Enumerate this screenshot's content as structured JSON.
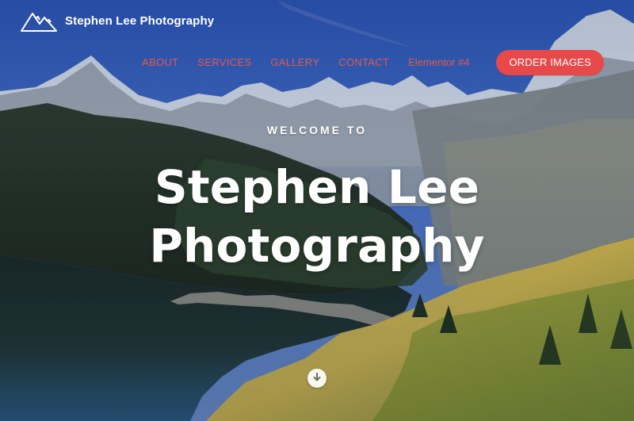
{
  "brand": {
    "name": "Stephen Lee Photography",
    "icon": "mountain-logo-icon"
  },
  "nav": {
    "items": [
      {
        "label": "ABOUT"
      },
      {
        "label": "SERVICES"
      },
      {
        "label": "GALLERY"
      },
      {
        "label": "CONTACT"
      },
      {
        "label": "Elementor #4"
      }
    ],
    "cta": {
      "label": "ORDER IMAGES"
    }
  },
  "hero": {
    "kicker": "WELCOME TO",
    "title_line1": "Stephen Lee",
    "title_line2": "Photography",
    "scroll_icon": "chevron-down-circle-icon"
  },
  "colors": {
    "accent": "#e7494a",
    "nav_link": "#e05a52",
    "hero_text": "#ffffff",
    "sky": "#2c56b5"
  }
}
